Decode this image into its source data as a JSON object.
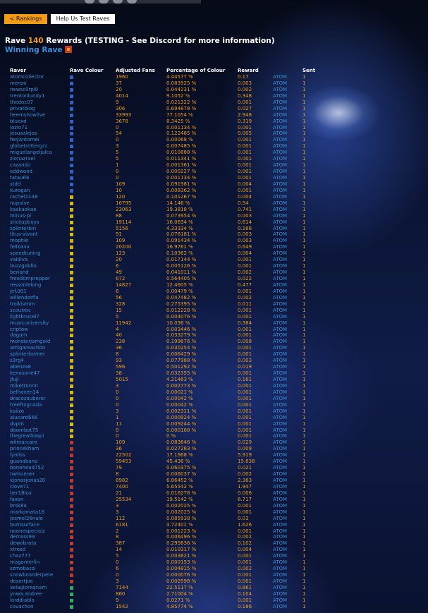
{
  "nav": {
    "rankings_label": "< Rankings",
    "help_label": "Help Us Test Raves"
  },
  "title": {
    "prefix": "Rave ",
    "number": "140",
    "suffix": " Rewards (TESTING - See Discord for more information)"
  },
  "winning_label": "Winning Rave",
  "headers": {
    "raver": "Raver",
    "colour": "Rave Colour",
    "fans": "Adjusted Fans",
    "pct": "Percentage of Colour",
    "reward": "Reward",
    "sent": "Sent"
  },
  "colors": {
    "blue": "#2f62c9",
    "yellow": "#d6b800",
    "red": "#c0392b",
    "green": "#27ae60",
    "accent": "#f39c12",
    "link": "#3a8ed6"
  },
  "rows": [
    {
      "name": "atomcollector",
      "colour": "blue",
      "fans": "1960",
      "pct": "4.44577 %",
      "reward": "0.17",
      "token": "ATOM",
      "sent": "1"
    },
    {
      "name": "menzo",
      "colour": "blue",
      "fans": "37",
      "pct": "0.083925 %",
      "reward": "0.003",
      "token": "ATOM",
      "sent": "1"
    },
    {
      "name": "newsc0rpi0",
      "colour": "blue",
      "fans": "20",
      "pct": "0.044231 %",
      "reward": "0.002",
      "token": "ATOM",
      "sent": "1"
    },
    {
      "name": "trentonlundy1",
      "colour": "blue",
      "fans": "4014",
      "pct": "9.1052 %",
      "reward": "0.348",
      "token": "ATOM",
      "sent": "1"
    },
    {
      "name": "thedoc07",
      "colour": "blue",
      "fans": "9",
      "pct": "0.021322 %",
      "reward": "0.001",
      "token": "ATOM",
      "sent": "1"
    },
    {
      "name": "privatblog",
      "colour": "blue",
      "fans": "306",
      "pct": "0.694878 %",
      "reward": "0.027",
      "token": "ATOM",
      "sent": "1"
    },
    {
      "name": "heemshowlive",
      "colour": "blue",
      "fans": "33993",
      "pct": "77.1054 %",
      "reward": "2.948",
      "token": "ATOM",
      "sent": "1"
    },
    {
      "name": "bluexd",
      "colour": "blue",
      "fans": "3678",
      "pct": "8.3425 %",
      "reward": "0.319",
      "token": "ATOM",
      "sent": "1"
    },
    {
      "name": "lozio71",
      "colour": "blue",
      "fans": "0",
      "pct": "0.001134 %",
      "reward": "0.001",
      "token": "ATOM",
      "sent": "1"
    },
    {
      "name": "jesusalejos",
      "colour": "blue",
      "fans": "54",
      "pct": "0.122485 %",
      "reward": "0.005",
      "token": "ATOM",
      "sent": "1"
    },
    {
      "name": "heyantomei",
      "colour": "blue",
      "fans": "0",
      "pct": "0.00068 %",
      "reward": "0.001",
      "token": "ATOM",
      "sent": "1"
    },
    {
      "name": "globetrottergcc",
      "colour": "blue",
      "fans": "3",
      "pct": "0.007485 %",
      "reward": "0.001",
      "token": "ATOM",
      "sent": "1"
    },
    {
      "name": "miguelangeljulca",
      "colour": "blue",
      "fans": "5",
      "pct": "0.010888 %",
      "reward": "0.001",
      "token": "ATOM",
      "sent": "1"
    },
    {
      "name": "zionazrael",
      "colour": "blue",
      "fans": "5",
      "pct": "0.011341 %",
      "reward": "0.001",
      "token": "ATOM",
      "sent": "1"
    },
    {
      "name": "cazando",
      "colour": "blue",
      "fans": "1",
      "pct": "0.001361 %",
      "reward": "0.001",
      "token": "ATOM",
      "sent": "1"
    },
    {
      "name": "eddwood",
      "colour": "blue",
      "fans": "0",
      "pct": "0.000227 %",
      "reward": "0.001",
      "token": "ATOM",
      "sent": "1"
    },
    {
      "name": "tatau66",
      "colour": "blue",
      "fans": "0",
      "pct": "0.001134 %",
      "reward": "0.001",
      "token": "ATOM",
      "sent": "1"
    },
    {
      "name": "stdd",
      "colour": "blue",
      "fans": "109",
      "pct": "0.091981 %",
      "reward": "0.004",
      "token": "ATOM",
      "sent": "1"
    },
    {
      "name": "kurogan",
      "colour": "blue",
      "fans": "10",
      "pct": "0.008362 %",
      "reward": "0.001",
      "token": "ATOM",
      "sent": "1"
    },
    {
      "name": "rachel1148",
      "colour": "yellow",
      "fans": "120",
      "pct": "0.101267 %",
      "reward": "0.004",
      "token": "ATOM",
      "sent": "1"
    },
    {
      "name": "nupulse",
      "colour": "yellow",
      "fans": "16795",
      "pct": "14.146 %",
      "reward": "0.54",
      "token": "ATOM",
      "sent": "1"
    },
    {
      "name": "kaakaokao",
      "colour": "yellow",
      "fans": "23063",
      "pct": "19.3818 %",
      "reward": "0.741",
      "token": "ATOM",
      "sent": "1"
    },
    {
      "name": "minus-pi",
      "colour": "yellow",
      "fans": "88",
      "pct": "0.073954 %",
      "reward": "0.003",
      "token": "ATOM",
      "sent": "1"
    },
    {
      "name": "stickupboys",
      "colour": "yellow",
      "fans": "19114",
      "pct": "16.0634 %",
      "reward": "0.614",
      "token": "ATOM",
      "sent": "1"
    },
    {
      "name": "splinterbin",
      "colour": "yellow",
      "fans": "5156",
      "pct": "4.33334 %",
      "reward": "0.166",
      "token": "ATOM",
      "sent": "1"
    },
    {
      "name": "titus-vivant",
      "colour": "yellow",
      "fans": "91",
      "pct": "0.076181 %",
      "reward": "0.003",
      "token": "ATOM",
      "sent": "1"
    },
    {
      "name": "mophie",
      "colour": "yellow",
      "fans": "109",
      "pct": "0.091434 %",
      "reward": "0.003",
      "token": "ATOM",
      "sent": "1"
    },
    {
      "name": "feltoxxx",
      "colour": "yellow",
      "fans": "20200",
      "pct": "16.9761 %",
      "reward": "0.649",
      "token": "ATOM",
      "sent": "1"
    },
    {
      "name": "speedtuning",
      "colour": "yellow",
      "fans": "123",
      "pct": "0.10362 %",
      "reward": "0.004",
      "token": "ATOM",
      "sent": "1"
    },
    {
      "name": "valdiva",
      "colour": "yellow",
      "fans": "20",
      "pct": "0.017144 %",
      "reward": "0.001",
      "token": "ATOM",
      "sent": "1"
    },
    {
      "name": "buzzgoblin",
      "colour": "yellow",
      "fans": "6",
      "pct": "0.005126 %",
      "reward": "0.001",
      "token": "ATOM",
      "sent": "1"
    },
    {
      "name": "beriand",
      "colour": "yellow",
      "fans": "49",
      "pct": "0.041011 %",
      "reward": "0.002",
      "token": "ATOM",
      "sent": "1"
    },
    {
      "name": "freedomprepper",
      "colour": "yellow",
      "fans": "672",
      "pct": "0.564405 %",
      "reward": "0.022",
      "token": "ATOM",
      "sent": "1"
    },
    {
      "name": "ressonlelong",
      "colour": "yellow",
      "fans": "14827",
      "pct": "12.4605 %",
      "reward": "0.477",
      "token": "ATOM",
      "sent": "1"
    },
    {
      "name": "jef.001",
      "colour": "yellow",
      "fans": "6",
      "pct": "0.00479 %",
      "reward": "0.001",
      "token": "ATOM",
      "sent": "1"
    },
    {
      "name": "willendorfia",
      "colour": "yellow",
      "fans": "56",
      "pct": "0.047482 %",
      "reward": "0.002",
      "token": "ATOM",
      "sent": "1"
    },
    {
      "name": "troikivmm",
      "colour": "yellow",
      "fans": "328",
      "pct": "0.275395 %",
      "reward": "0.011",
      "token": "ATOM",
      "sent": "1"
    },
    {
      "name": "scoutroc",
      "colour": "yellow",
      "fans": "15",
      "pct": "0.012228 %",
      "reward": "0.001",
      "token": "ATOM",
      "sent": "1"
    },
    {
      "name": "lightbrucel7",
      "colour": "yellow",
      "fans": "5",
      "pct": "0.004076 %",
      "reward": "0.001",
      "token": "ATOM",
      "sent": "1"
    },
    {
      "name": "musicuniversity",
      "colour": "yellow",
      "fans": "11942",
      "pct": "10.036 %",
      "reward": "0.384",
      "token": "ATOM",
      "sent": "1"
    },
    {
      "name": "criptow",
      "colour": "yellow",
      "fans": "4",
      "pct": "0.003446 %",
      "reward": "0.001",
      "token": "ATOM",
      "sent": "1"
    },
    {
      "name": "dagum",
      "colour": "yellow",
      "fans": "40",
      "pct": "0.033279 %",
      "reward": "0.001",
      "token": "ATOM",
      "sent": "1"
    },
    {
      "name": "monsterjamgold",
      "colour": "yellow",
      "fans": "238",
      "pct": "0.199676 %",
      "reward": "0.008",
      "token": "ATOM",
      "sent": "1"
    },
    {
      "name": "amigareaction",
      "colour": "yellow",
      "fans": "36",
      "pct": "0.030254 %",
      "reward": "0.001",
      "token": "ATOM",
      "sent": "1"
    },
    {
      "name": "splinterfarmer",
      "colour": "yellow",
      "fans": "8",
      "pct": "0.006429 %",
      "reward": "0.001",
      "token": "ATOM",
      "sent": "1"
    },
    {
      "name": "s3rg4",
      "colour": "yellow",
      "fans": "93",
      "pct": "0.077988 %",
      "reward": "0.003",
      "token": "ATOM",
      "sent": "1"
    },
    {
      "name": "abenza8",
      "colour": "yellow",
      "fans": "596",
      "pct": "0.501292 %",
      "reward": "0.019",
      "token": "ATOM",
      "sent": "1"
    },
    {
      "name": "kenosone47",
      "colour": "yellow",
      "fans": "38",
      "pct": "0.032355 %",
      "reward": "0.001",
      "token": "ATOM",
      "sent": "1"
    },
    {
      "name": "jfuji",
      "colour": "yellow",
      "fans": "5015",
      "pct": "4.21463 %",
      "reward": "0.161",
      "token": "ATOM",
      "sent": "1"
    },
    {
      "name": "miketronnn",
      "colour": "yellow",
      "fans": "3",
      "pct": "0.002773 %",
      "reward": "0.001",
      "token": "ATOM",
      "sent": "1"
    },
    {
      "name": "belhaven14",
      "colour": "yellow",
      "fans": "0",
      "pct": "0.00021 %",
      "reward": "0.001",
      "token": "ATOM",
      "sent": "1"
    },
    {
      "name": "dracozauberer",
      "colour": "yellow",
      "fans": "0",
      "pct": "0.00042 %",
      "reward": "0.001",
      "token": "ATOM",
      "sent": "1"
    },
    {
      "name": "treefrognada",
      "colour": "yellow",
      "fans": "0",
      "pct": "0.00042 %",
      "reward": "0.001",
      "token": "ATOM",
      "sent": "1"
    },
    {
      "name": "kaiizo",
      "colour": "yellow",
      "fans": "3",
      "pct": "0.002311 %",
      "reward": "0.001",
      "token": "ATOM",
      "sent": "1"
    },
    {
      "name": "alucard666",
      "colour": "yellow",
      "fans": "1",
      "pct": "0.000924 %",
      "reward": "0.001",
      "token": "ATOM",
      "sent": "1"
    },
    {
      "name": "dvpm",
      "colour": "yellow",
      "fans": "11",
      "pct": "0.009244 %",
      "reward": "0.001",
      "token": "ATOM",
      "sent": "1"
    },
    {
      "name": "doombot75",
      "colour": "yellow",
      "fans": "0",
      "pct": "0.000168 %",
      "reward": "0.001",
      "token": "ATOM",
      "sent": "1"
    },
    {
      "name": "thegreatkaspi",
      "colour": "yellow",
      "fans": "0",
      "pct": "0 %",
      "reward": "0.001",
      "token": "ATOM",
      "sent": "1"
    },
    {
      "name": "wilmarcaro",
      "colour": "red",
      "fans": "109",
      "pct": "0.083646 %",
      "reward": "0.029",
      "token": "ATOM",
      "sent": "1"
    },
    {
      "name": "princekham",
      "colour": "red",
      "fans": "36",
      "pct": "0.027283 %",
      "reward": "0.009",
      "token": "ATOM",
      "sent": "1"
    },
    {
      "name": "lynliss",
      "colour": "red",
      "fans": "22502",
      "pct": "17.1968 %",
      "reward": "5.919",
      "token": "ATOM",
      "sent": "1"
    },
    {
      "name": "guanabana",
      "colour": "red",
      "fans": "59453",
      "pct": "45.436 %",
      "reward": "15.638",
      "token": "ATOM",
      "sent": "1"
    },
    {
      "name": "bonehead752",
      "colour": "red",
      "fans": "79",
      "pct": "0.060375 %",
      "reward": "0.021",
      "token": "ATOM",
      "sent": "1"
    },
    {
      "name": "nwlrunner",
      "colour": "red",
      "fans": "8",
      "pct": "0.006037 %",
      "reward": "0.002",
      "token": "ATOM",
      "sent": "1"
    },
    {
      "name": "xjonasjonas20",
      "colour": "red",
      "fans": "8982",
      "pct": "6.86452 %",
      "reward": "2.363",
      "token": "ATOM",
      "sent": "1"
    },
    {
      "name": "clove71",
      "colour": "red",
      "fans": "7400",
      "pct": "5.65542 %",
      "reward": "1.947",
      "token": "ATOM",
      "sent": "1"
    },
    {
      "name": "her18lux",
      "colour": "red",
      "fans": "21",
      "pct": "0.016278 %",
      "reward": "0.006",
      "token": "ATOM",
      "sent": "1"
    },
    {
      "name": "faxon",
      "colour": "red",
      "fans": "25534",
      "pct": "19.5142 %",
      "reward": "6.717",
      "token": "ATOM",
      "sent": "1"
    },
    {
      "name": "brsk84",
      "colour": "red",
      "fans": "3",
      "pct": "0.002025 %",
      "reward": "0.001",
      "token": "ATOM",
      "sent": "1"
    },
    {
      "name": "markomata16",
      "colour": "red",
      "fans": "3",
      "pct": "0.002025 %",
      "reward": "0.001",
      "token": "ATOM",
      "sent": "1"
    },
    {
      "name": "jesmel26nalo",
      "colour": "red",
      "fans": "112",
      "pct": "0.085938 %",
      "reward": "0.03",
      "token": "ATOM",
      "sent": "1"
    },
    {
      "name": "burnsurface",
      "colour": "red",
      "fans": "6181",
      "pct": "4.72401 %",
      "reward": "1.626",
      "token": "ATOM",
      "sent": "1"
    },
    {
      "name": "noonespecialz",
      "colour": "red",
      "fans": "2",
      "pct": "0.001223 %",
      "reward": "0.001",
      "token": "ATOM",
      "sent": "1"
    },
    {
      "name": "demsss99",
      "colour": "red",
      "fans": "8",
      "pct": "0.006496 %",
      "reward": "0.002",
      "token": "ATOM",
      "sent": "1"
    },
    {
      "name": "dewobrata",
      "colour": "red",
      "fans": "387",
      "pct": "0.295836 %",
      "reward": "0.102",
      "token": "ATOM",
      "sent": "1"
    },
    {
      "name": "xtroxd",
      "colour": "red",
      "fans": "14",
      "pct": "0.010317 %",
      "reward": "0.004",
      "token": "ATOM",
      "sent": "1"
    },
    {
      "name": "chaz777",
      "colour": "red",
      "fans": "5",
      "pct": "0.003821 %",
      "reward": "0.001",
      "token": "ATOM",
      "sent": "1"
    },
    {
      "name": "magomerlin",
      "colour": "red",
      "fans": "0",
      "pct": "0.000153 %",
      "reward": "0.001",
      "token": "ATOM",
      "sent": "1"
    },
    {
      "name": "szmobacsi",
      "colour": "red",
      "fans": "6",
      "pct": "0.004815 %",
      "reward": "0.002",
      "token": "ATOM",
      "sent": "1"
    },
    {
      "name": "snowboarderpete",
      "colour": "red",
      "fans": "0",
      "pct": "0.000076 %",
      "reward": "0.001",
      "token": "ATOM",
      "sent": "1"
    },
    {
      "name": "desertjoe",
      "colour": "red",
      "fans": "3",
      "pct": "0.002598 %",
      "reward": "0.001",
      "token": "ATOM",
      "sent": "1"
    },
    {
      "name": "xelagioreqnam",
      "colour": "green",
      "fans": "7144",
      "pct": "22.5117 %",
      "reward": "0.861",
      "token": "ATOM",
      "sent": "1"
    },
    {
      "name": "ynwa.andree",
      "colour": "green",
      "fans": "860",
      "pct": "2.71004 %",
      "reward": "0.104",
      "token": "ATOM",
      "sent": "1"
    },
    {
      "name": "lorddiablo",
      "colour": "green",
      "fans": "9",
      "pct": "0.0271 %",
      "reward": "0.001",
      "token": "ATOM",
      "sent": "1"
    },
    {
      "name": "cavachon",
      "colour": "green",
      "fans": "1542",
      "pct": "4.85774 %",
      "reward": "0.186",
      "token": "ATOM",
      "sent": "1"
    }
  ]
}
